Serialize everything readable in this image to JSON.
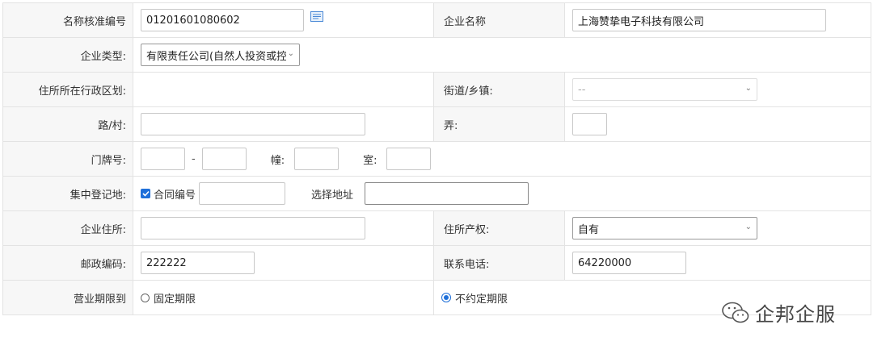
{
  "form": {
    "name_check_no": {
      "label": "名称核准编号",
      "value": "01201601080602"
    },
    "company_name": {
      "label": "企业名称",
      "value": "上海赞挚电子科技有限公司"
    },
    "company_type": {
      "label": "企业类型:",
      "selected": "有限责任公司(自然人投资或控"
    },
    "admin_region": {
      "label": "住所所在行政区划:"
    },
    "street_town": {
      "label": "街道/乡镇:",
      "selected": "--"
    },
    "road_village": {
      "label": "路/村:",
      "value": ""
    },
    "lane": {
      "label": "弄:",
      "value": ""
    },
    "door_no": {
      "label": "门牌号:",
      "dash": "-",
      "building_label": "幢:",
      "room_label": "室:"
    },
    "central_reg": {
      "label": "集中登记地:",
      "checkbox_label": "合同编号",
      "checked": true,
      "select_addr_label": "选择地址"
    },
    "company_address": {
      "label": "企业住所:",
      "value": ""
    },
    "property_right": {
      "label": "住所产权:",
      "selected": "自有"
    },
    "postal_code": {
      "label": "邮政编码:",
      "value": "222222"
    },
    "phone": {
      "label": "联系电话:",
      "value": "64220000"
    },
    "business_term": {
      "label": "营业期限到",
      "fixed_label": "固定期限",
      "unfixed_label": "不约定期限",
      "selected": "unfixed"
    }
  },
  "watermark": {
    "text": "企邦企服"
  },
  "colors": {
    "accent": "#1e6fd9",
    "label_bg": "#f7f7f7",
    "border": "#e3e3e3"
  }
}
